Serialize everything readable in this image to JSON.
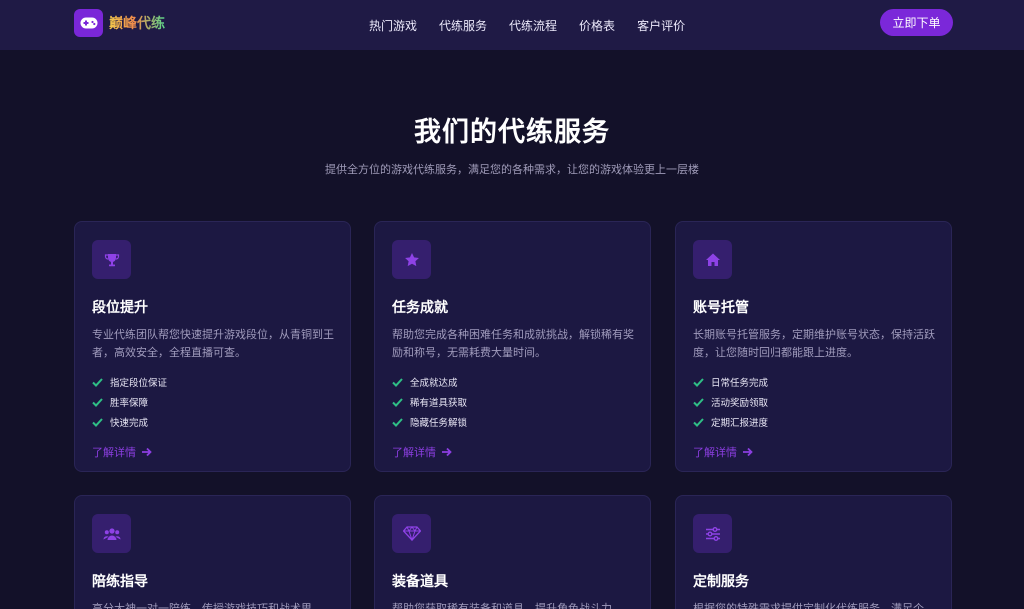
{
  "brand": {
    "name": "巅峰代练",
    "icon": "gamepad-icon"
  },
  "nav": {
    "links": [
      "热门游戏",
      "代练服务",
      "代练流程",
      "价格表",
      "客户评价"
    ],
    "cta": "立即下单"
  },
  "section": {
    "title": "我们的代练服务",
    "subtitle": "提供全方位的游戏代练服务，满足您的各种需求，让您的游戏体验更上一层楼"
  },
  "colors": {
    "accent": "#7b28d9",
    "check": "#2fbf86",
    "card_bg": "#1c1842",
    "page_bg": "#131129"
  },
  "cards": [
    {
      "icon": "trophy-icon",
      "title": "段位提升",
      "desc": "专业代练团队帮您快速提升游戏段位，从青铜到王者，高效安全，全程直播可查。",
      "features": [
        "指定段位保证",
        "胜率保障",
        "快速完成"
      ],
      "link": "了解详情"
    },
    {
      "icon": "star-icon",
      "title": "任务成就",
      "desc": "帮助您完成各种困难任务和成就挑战，解锁稀有奖励和称号，无需耗费大量时间。",
      "features": [
        "全成就达成",
        "稀有道具获取",
        "隐藏任务解锁"
      ],
      "link": "了解详情"
    },
    {
      "icon": "home-icon",
      "title": "账号托管",
      "desc": "长期账号托管服务，定期维护账号状态，保持活跃度，让您随时回归都能跟上进度。",
      "features": [
        "日常任务完成",
        "活动奖励领取",
        "定期汇报进度"
      ],
      "link": "了解详情"
    },
    {
      "icon": "users-icon",
      "title": "陪练指导",
      "desc": "高分大神一对一陪练，传授游戏技巧和战术思",
      "features": [],
      "link": ""
    },
    {
      "icon": "gem-icon",
      "title": "装备道具",
      "desc": "帮助您获取稀有装备和道具，提升角色战斗力，",
      "features": [],
      "link": ""
    },
    {
      "icon": "sliders-icon",
      "title": "定制服务",
      "desc": "根据您的特殊需求提供定制化代练服务，满足个",
      "features": [],
      "link": ""
    }
  ]
}
